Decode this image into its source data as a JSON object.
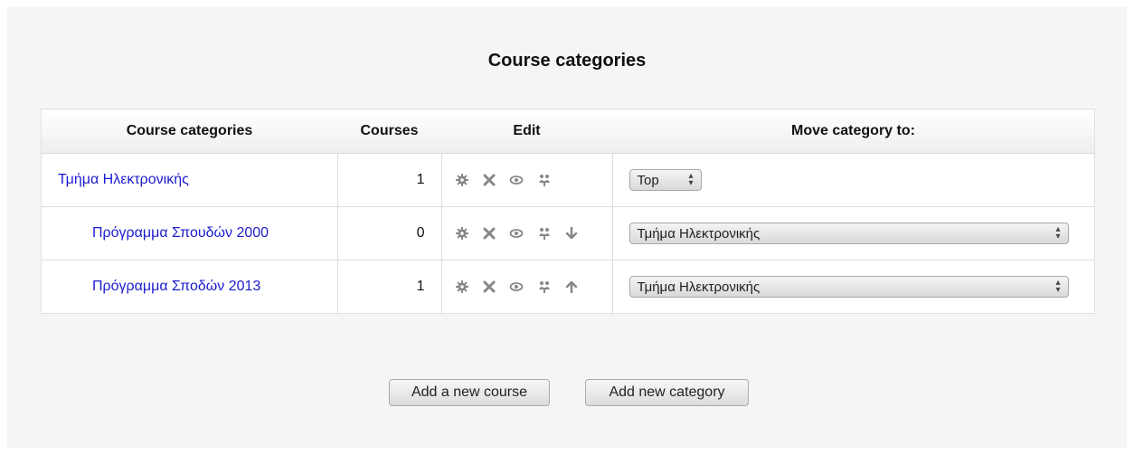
{
  "page_title": "Course categories",
  "table": {
    "headers": {
      "name": "Course categories",
      "courses": "Courses",
      "edit": "Edit",
      "move": "Move category to:"
    },
    "rows": [
      {
        "name": "Τμήμα Ηλεκτρονικής",
        "courses": "1",
        "move_to": "Top",
        "icons": [
          "gear-icon",
          "delete-icon",
          "eye-icon",
          "cohort-icon"
        ]
      },
      {
        "name": "Πρόγραμμα Σπουδών 2000",
        "courses": "0",
        "move_to": "Τμήμα Ηλεκτρονικής",
        "icons": [
          "gear-icon",
          "delete-icon",
          "eye-icon",
          "cohort-icon",
          "arrow-down-icon"
        ]
      },
      {
        "name": "Πρόγραμμα Σποδών 2013",
        "courses": "1",
        "move_to": "Τμήμα Ηλεκτρονικής",
        "icons": [
          "gear-icon",
          "delete-icon",
          "eye-icon",
          "cohort-icon",
          "arrow-up-icon"
        ]
      }
    ]
  },
  "buttons": {
    "add_course": "Add a new course",
    "add_category": "Add new category"
  },
  "colors": {
    "link": "#1b1bd0",
    "icon": "#888888"
  }
}
